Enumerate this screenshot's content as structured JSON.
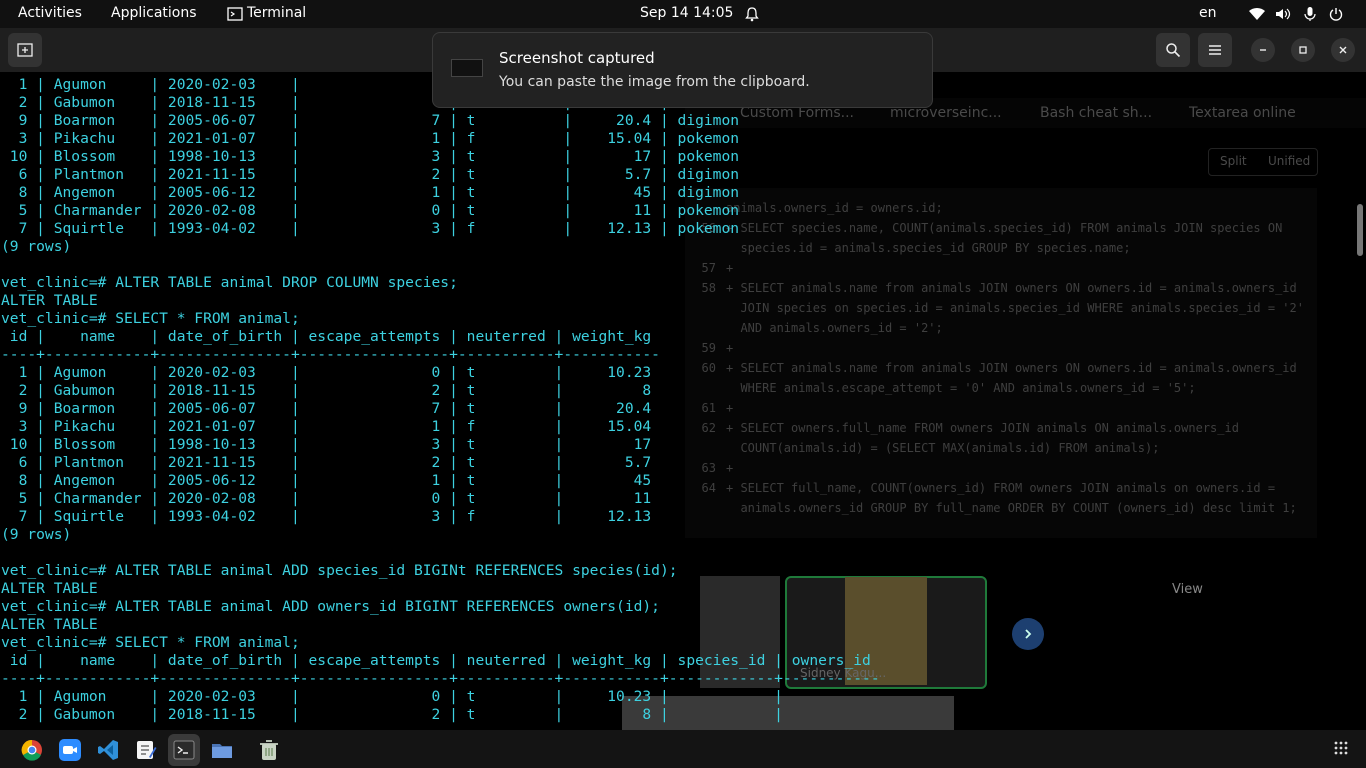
{
  "topbar": {
    "activities": "Activities",
    "applications": "Applications",
    "terminal_label": "Terminal",
    "datetime": "Sep 14  14:05",
    "language": "en"
  },
  "notification": {
    "title": "Screenshot captured",
    "body": "You can paste the image from the clipboard."
  },
  "terminal": {
    "lines": [
      "  1 | Agumon     | 2020-02-03    |                 |            |          |",
      "  2 | Gabumon    | 2018-11-15    |                 |            |          |",
      "  9 | Boarmon    | 2005-06-07    |               7 | t          |     20.4 | digimon",
      "  3 | Pikachu    | 2021-01-07    |               1 | f          |    15.04 | pokemon",
      " 10 | Blossom    | 1998-10-13    |               3 | t          |       17 | pokemon",
      "  6 | Plantmon   | 2021-11-15    |               2 | t          |      5.7 | digimon",
      "  8 | Angemon    | 2005-06-12    |               1 | t          |       45 | digimon",
      "  5 | Charmander | 2020-02-08    |               0 | t          |       11 | pokemon",
      "  7 | Squirtle   | 1993-04-02    |               3 | f          |    12.13 | pokemon",
      "(9 rows)",
      "",
      "vet_clinic=# ALTER TABLE animal DROP COLUMN species;",
      "ALTER TABLE",
      "vet_clinic=# SELECT * FROM animal;",
      " id |    name    | date_of_birth | escape_attempts | neuterred | weight_kg",
      "----+------------+---------------+-----------------+-----------+-----------",
      "  1 | Agumon     | 2020-02-03    |               0 | t         |     10.23",
      "  2 | Gabumon    | 2018-11-15    |               2 | t         |         8",
      "  9 | Boarmon    | 2005-06-07    |               7 | t         |      20.4",
      "  3 | Pikachu    | 2021-01-07    |               1 | f         |     15.04",
      " 10 | Blossom    | 1998-10-13    |               3 | t         |        17",
      "  6 | Plantmon   | 2021-11-15    |               2 | t         |       5.7",
      "  8 | Angemon    | 2005-06-12    |               1 | t         |        45",
      "  5 | Charmander | 2020-02-08    |               0 | t         |        11",
      "  7 | Squirtle   | 1993-04-02    |               3 | f         |     12.13",
      "(9 rows)",
      "",
      "vet_clinic=# ALTER TABLE animal ADD species_id BIGINt REFERENCES species(id);",
      "ALTER TABLE",
      "vet_clinic=# ALTER TABLE animal ADD owners_id BIGINT REFERENCES owners(id);",
      "ALTER TABLE",
      "vet_clinic=# SELECT * FROM animal;",
      " id |    name    | date_of_birth | escape_attempts | neuterred | weight_kg | species_id | owners_id",
      "----+------------+---------------+-----------------+-----------+-----------+------------+-----------",
      "  1 | Agumon     | 2020-02-03    |               0 | t         |     10.23 |            |",
      "  2 | Gabumon    | 2018-11-15    |               2 | t         |         8 |            |"
    ]
  },
  "ghost": {
    "browser_tabs": [
      "Custom Forms...",
      "microverseinc...",
      "Bash cheat sh...",
      "Textarea online"
    ],
    "diff_buttons": [
      "Split",
      "Unified"
    ],
    "code_lines": [
      {
        "num": "",
        "text": "animals.owners_id = owners.id;"
      },
      {
        "num": "56",
        "text": "+ SELECT species.name, COUNT(animals.species_id) FROM animals JOIN species ON"
      },
      {
        "num": "",
        "text": "  species.id = animals.species_id GROUP BY species.name;"
      },
      {
        "num": "57",
        "text": "+"
      },
      {
        "num": "58",
        "text": "+ SELECT animals.name from animals JOIN owners ON owners.id = animals.owners_id"
      },
      {
        "num": "",
        "text": "  JOIN species on species.id = animals.species_id WHERE animals.species_id = '2'"
      },
      {
        "num": "",
        "text": "  AND animals.owners_id = '2';"
      },
      {
        "num": "59",
        "text": "+"
      },
      {
        "num": "60",
        "text": "+ SELECT animals.name from animals JOIN owners ON owners.id = animals.owners_id"
      },
      {
        "num": "",
        "text": "  WHERE animals.escape_attempt = '0' AND animals.owners_id = '5';"
      },
      {
        "num": "61",
        "text": "+"
      },
      {
        "num": "62",
        "text": "+ SELECT owners.full_name FROM owners JOIN animals ON animals.owners_id"
      },
      {
        "num": "",
        "text": "  COUNT(animals.id) = (SELECT MAX(animals.id) FROM animals);"
      },
      {
        "num": "63",
        "text": "+"
      },
      {
        "num": "64",
        "text": "+ SELECT full_name, COUNT(owners_id) FROM owners JOIN animals on owners.id ="
      },
      {
        "num": "",
        "text": "  animals.owners_id GROUP BY full_name ORDER BY COUNT (owners_id) desc limit 1;"
      }
    ],
    "view_label": "View",
    "meet_name": "Sidney Kagu..."
  },
  "dock": {
    "apps": [
      "chrome-icon",
      "zoom-icon",
      "vscode-icon",
      "text-editor-icon",
      "terminal-icon",
      "files-icon",
      "trash-icon"
    ]
  },
  "colors": {
    "terminal_text": "#3dd1e0",
    "topbar_bg": "#111111",
    "notification_bg": "#222222"
  }
}
